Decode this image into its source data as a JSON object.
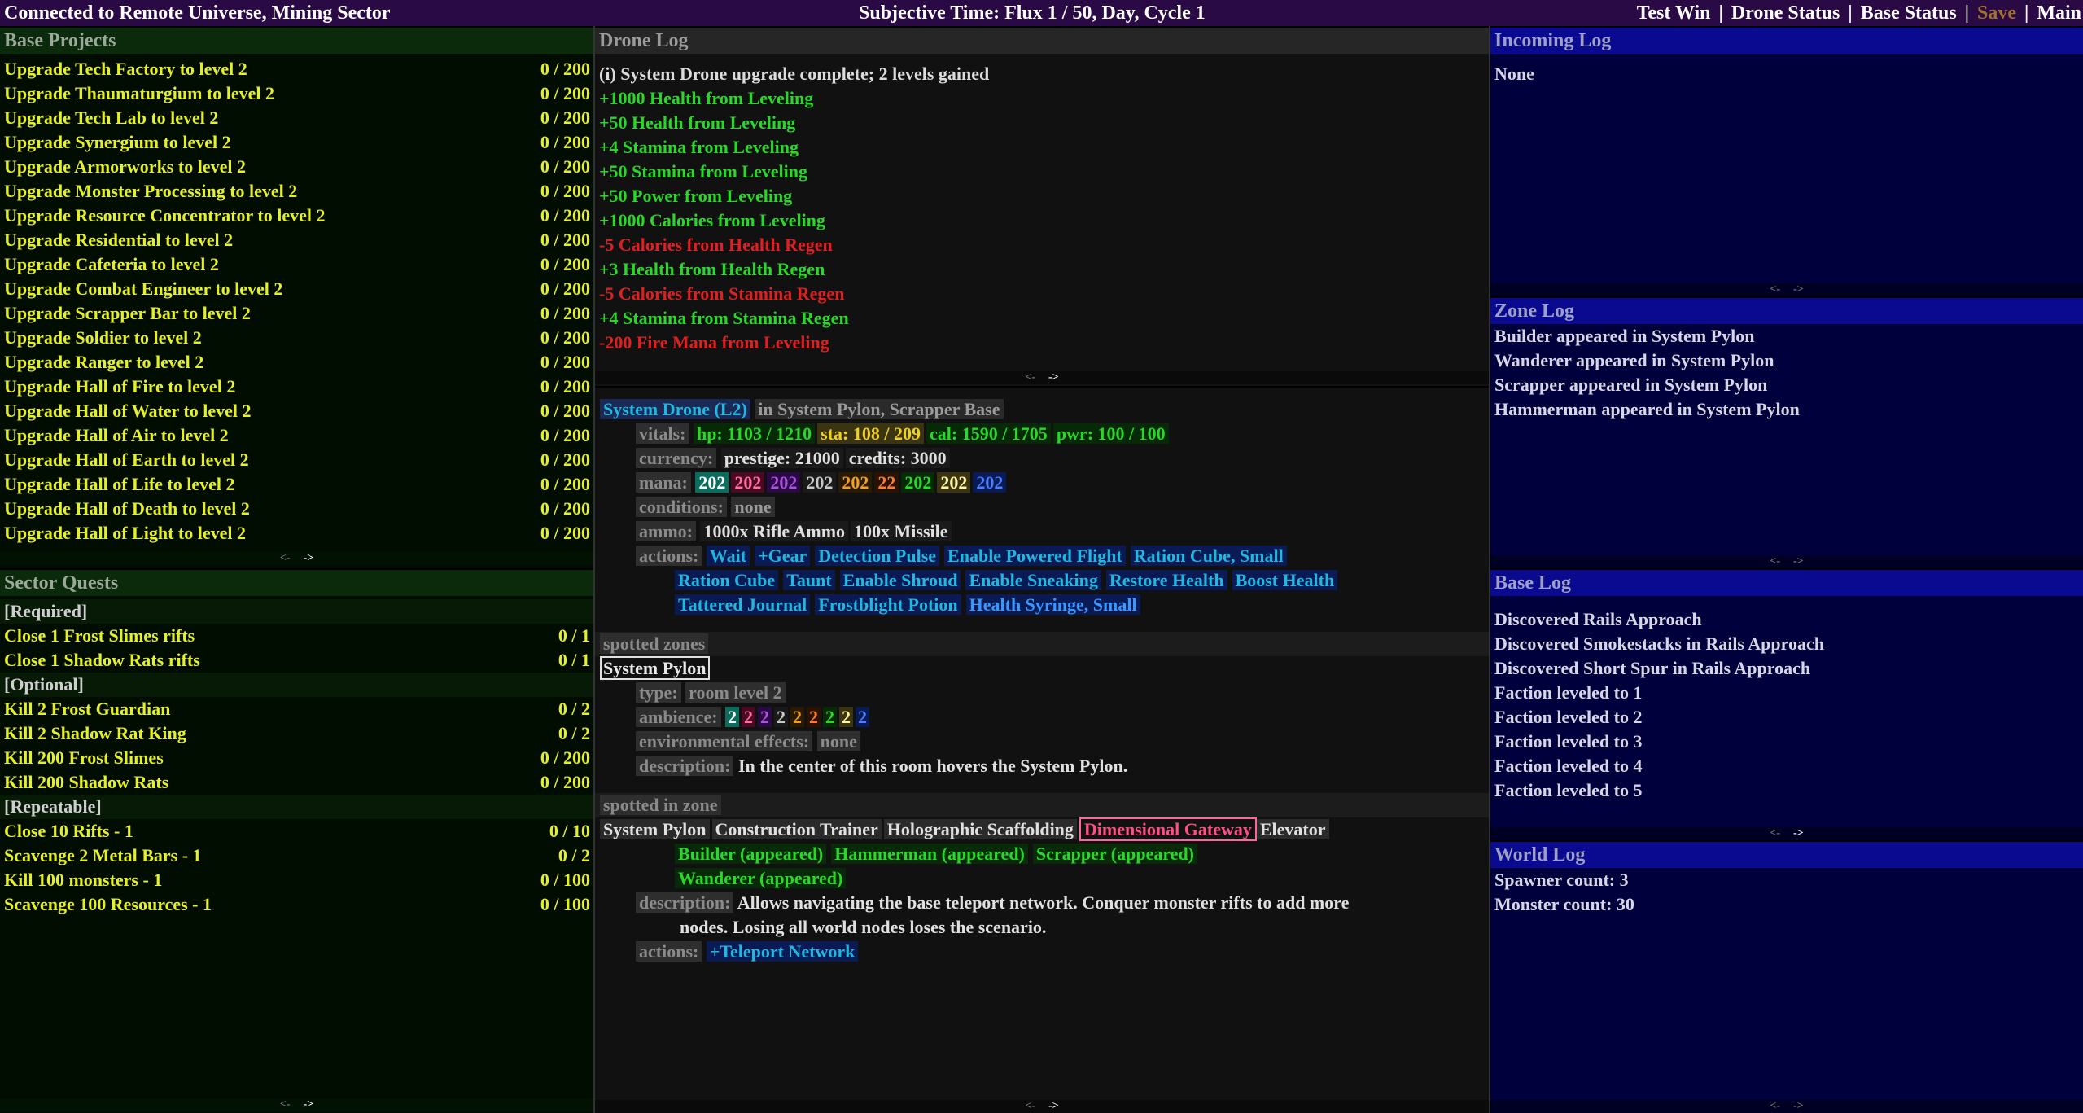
{
  "topbar": {
    "connection": "Connected to Remote Universe, Mining Sector",
    "time": "Subjective Time: Flux 1 / 50,  Day, Cycle 1",
    "menu": [
      "Test Win",
      "Drone Status",
      "Base Status",
      "Save",
      "Main"
    ]
  },
  "base_projects": {
    "title": "Base Projects",
    "items": [
      {
        "name": "Upgrade Tech Factory to level 2",
        "progress": "0 / 200"
      },
      {
        "name": "Upgrade Thaumaturgium to level 2",
        "progress": "0 / 200"
      },
      {
        "name": "Upgrade Tech Lab to level 2",
        "progress": "0 / 200"
      },
      {
        "name": "Upgrade Synergium to level 2",
        "progress": "0 / 200"
      },
      {
        "name": "Upgrade Armorworks to level 2",
        "progress": "0 / 200"
      },
      {
        "name": "Upgrade Monster Processing to level 2",
        "progress": "0 / 200"
      },
      {
        "name": "Upgrade Resource Concentrator to level 2",
        "progress": "0 / 200"
      },
      {
        "name": "Upgrade Residential to level 2",
        "progress": "0 / 200"
      },
      {
        "name": "Upgrade Cafeteria to level 2",
        "progress": "0 / 200"
      },
      {
        "name": "Upgrade Combat Engineer to level 2",
        "progress": "0 / 200"
      },
      {
        "name": "Upgrade Scrapper Bar to level 2",
        "progress": "0 / 200"
      },
      {
        "name": "Upgrade Soldier to level 2",
        "progress": "0 / 200"
      },
      {
        "name": "Upgrade Ranger to level 2",
        "progress": "0 / 200"
      },
      {
        "name": "Upgrade Hall of Fire to level 2",
        "progress": "0 / 200"
      },
      {
        "name": "Upgrade Hall of Water to level 2",
        "progress": "0 / 200"
      },
      {
        "name": "Upgrade Hall of Air to level 2",
        "progress": "0 / 200"
      },
      {
        "name": "Upgrade Hall of Earth to level 2",
        "progress": "0 / 200"
      },
      {
        "name": "Upgrade Hall of Life to level 2",
        "progress": "0 / 200"
      },
      {
        "name": "Upgrade Hall of Death to level 2",
        "progress": "0 / 200"
      },
      {
        "name": "Upgrade Hall of Light to level 2",
        "progress": "0 / 200"
      }
    ]
  },
  "scroll": {
    "back": "<-",
    "fwd": "->"
  },
  "sector_quests": {
    "title": "Sector Quests",
    "rows": [
      {
        "name": "[Required]",
        "progress": "",
        "sub": true
      },
      {
        "name": "Close 1 Frost Slimes rifts",
        "progress": "0 / 1"
      },
      {
        "name": "Close 1 Shadow Rats rifts",
        "progress": "0 / 1"
      },
      {
        "name": "[Optional]",
        "progress": "",
        "sub": true
      },
      {
        "name": "Kill 2 Frost Guardian",
        "progress": "0 / 2"
      },
      {
        "name": "Kill 2 Shadow Rat King",
        "progress": "0 / 2"
      },
      {
        "name": "Kill 200 Frost Slimes",
        "progress": "0 / 200"
      },
      {
        "name": "Kill 200 Shadow Rats",
        "progress": "0 / 200"
      },
      {
        "name": "[Repeatable]",
        "progress": "",
        "sub": true
      },
      {
        "name": "Close 10 Rifts - 1",
        "progress": "0 / 10"
      },
      {
        "name": "Scavenge 2 Metal Bars - 1",
        "progress": "0 / 2"
      },
      {
        "name": "Kill 100 monsters - 1",
        "progress": "0 / 100"
      },
      {
        "name": "Scavenge 100 Resources - 1",
        "progress": "0 / 100"
      }
    ]
  },
  "drone_log": {
    "title": "Drone Log",
    "lines": [
      {
        "text": "(i) System Drone upgrade complete; 2 levels gained",
        "kind": "w"
      },
      {
        "text": "+1000 Health from Leveling",
        "kind": "g"
      },
      {
        "text": "+50 Health from Leveling",
        "kind": "g"
      },
      {
        "text": "+4 Stamina from Leveling",
        "kind": "g"
      },
      {
        "text": "+50 Stamina from Leveling",
        "kind": "g"
      },
      {
        "text": "+50 Power from Leveling",
        "kind": "g"
      },
      {
        "text": "+1000 Calories from Leveling",
        "kind": "g"
      },
      {
        "text": "-5 Calories from Health Regen",
        "kind": "r"
      },
      {
        "text": "+3 Health from Health Regen",
        "kind": "g"
      },
      {
        "text": "-5 Calories from Stamina Regen",
        "kind": "r"
      },
      {
        "text": "+4 Stamina from Stamina Regen",
        "kind": "g"
      },
      {
        "text": "-200 Fire Mana from Leveling",
        "kind": "r"
      }
    ]
  },
  "drone": {
    "name": "System Drone (L2)",
    "location": "in System Pylon, Scrapper Base",
    "labels": {
      "vitals": "vitals:",
      "currency": "currency:",
      "mana": "mana:",
      "conditions": "conditions:",
      "ammo": "ammo:",
      "actions": "actions:"
    },
    "vitals": {
      "hp": "hp: 1103 / 1210",
      "sta": "sta: 108 / 209",
      "cal": "cal: 1590 / 1705",
      "pwr": "pwr: 100 / 100"
    },
    "currency": {
      "prestige": "prestige: 21000",
      "credits": "credits: 3000"
    },
    "mana": [
      {
        "v": "202",
        "fg": "#ffffff",
        "bg": "#0b6d5e"
      },
      {
        "v": "202",
        "fg": "#ff6f9a",
        "bg": "#4a0a24"
      },
      {
        "v": "202",
        "fg": "#b050e0",
        "bg": "#2a0a44"
      },
      {
        "v": "202",
        "fg": "#c8c8c8",
        "bg": "#1a1a1a"
      },
      {
        "v": "202",
        "fg": "#f0a020",
        "bg": "#2a1a00"
      },
      {
        "v": "22",
        "fg": "#ff7a30",
        "bg": "#2a1200"
      },
      {
        "v": "202",
        "fg": "#2ad82a",
        "bg": "#062a06"
      },
      {
        "v": "202",
        "fg": "#fff4a0",
        "bg": "#3a3410"
      },
      {
        "v": "202",
        "fg": "#4a80ff",
        "bg": "#0a1a55"
      }
    ],
    "conditions": "none",
    "ammo": [
      "1000x Rifle Ammo",
      "100x Missile"
    ],
    "actions_row1": [
      "Wait",
      "+Gear",
      "Detection Pulse",
      "Enable Powered Flight",
      "Ration Cube, Small"
    ],
    "actions_row2": [
      "Ration Cube",
      "Taunt",
      "Enable Shroud",
      "Enable Sneaking",
      "Restore Health",
      "Boost Health"
    ],
    "actions_row3": [
      "Tattered Journal",
      "Frostblight Potion",
      "Health Syringe, Small"
    ]
  },
  "spotted_zones": {
    "title": "spotted zones",
    "zone": "System Pylon",
    "labels": {
      "type": "type:",
      "ambience": "ambience:",
      "effects": "environmental effects:",
      "description": "description:"
    },
    "type": "room level 2",
    "ambience": [
      {
        "v": "2",
        "fg": "#ffffff",
        "bg": "#0b6d5e"
      },
      {
        "v": "2",
        "fg": "#ff6f9a",
        "bg": "#4a0a24"
      },
      {
        "v": "2",
        "fg": "#b050e0",
        "bg": "#2a0a44"
      },
      {
        "v": "2",
        "fg": "#c8c8c8",
        "bg": "#1a1a1a"
      },
      {
        "v": "2",
        "fg": "#f0a020",
        "bg": "#2a1a00"
      },
      {
        "v": "2",
        "fg": "#ff7a30",
        "bg": "#2a1200"
      },
      {
        "v": "2",
        "fg": "#2ad82a",
        "bg": "#062a06"
      },
      {
        "v": "2",
        "fg": "#fff4a0",
        "bg": "#3a3410"
      },
      {
        "v": "2",
        "fg": "#4a80ff",
        "bg": "#0a1a55"
      }
    ],
    "effects": "none",
    "description": "In the center of this room hovers the System Pylon."
  },
  "spotted_in_zone": {
    "title": "spotted in zone",
    "entities": [
      "System Pylon",
      "Construction Trainer",
      "Holographic Scaffolding",
      "Dimensional Gateway",
      "Elevator"
    ],
    "appeared_row1": [
      "Builder (appeared)",
      "Hammerman (appeared)",
      "Scrapper (appeared)"
    ],
    "appeared_row2": [
      "Wanderer (appeared)"
    ],
    "labels": {
      "description": "description:",
      "actions": "actions:"
    },
    "description_line1": "Allows navigating the base teleport network. Conquer monster rifts to add more",
    "description_line2": "nodes. Losing all world nodes loses the scenario.",
    "action": "+Teleport Network"
  },
  "incoming_log": {
    "title": "Incoming Log",
    "lines": [
      "None"
    ]
  },
  "zone_log": {
    "title": "Zone Log",
    "lines": [
      "Builder appeared in System Pylon",
      "Wanderer appeared in System Pylon",
      "Scrapper appeared in System Pylon",
      "Hammerman appeared in System Pylon"
    ]
  },
  "base_log": {
    "title": "Base Log",
    "lines": [
      "Discovered Rails Approach",
      "Discovered Smokestacks in Rails Approach",
      "Discovered Short Spur in Rails Approach",
      "Faction leveled to 1",
      "Faction leveled to 2",
      "Faction leveled to 3",
      "Faction leveled to 4",
      "Faction leveled to 5"
    ]
  },
  "world_log": {
    "title": "World Log",
    "lines": [
      "Spawner count: 3",
      "Monster count: 30"
    ]
  },
  "colors": {
    "accent_yellow": "#e6f028",
    "log_green": "#2ad82a",
    "log_red": "#e02020",
    "pane_blue": "#00003c"
  }
}
